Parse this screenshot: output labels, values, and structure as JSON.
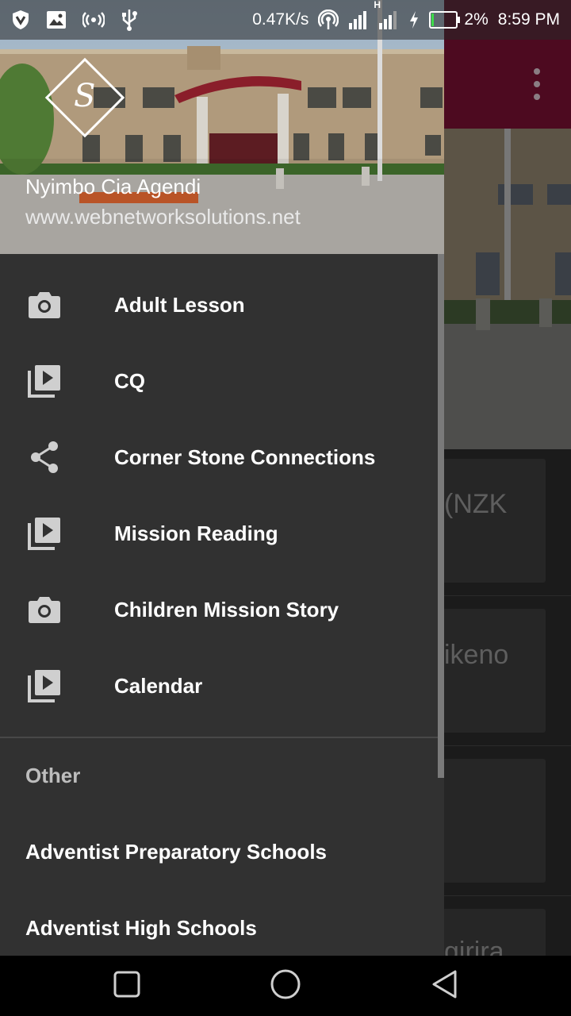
{
  "status_bar": {
    "speed": "0.47K/s",
    "network_type": "H",
    "battery": "2%",
    "time": "8:59 PM",
    "left_icons": [
      "shield-icon",
      "image-icon",
      "hotspot-icon",
      "usb-icon"
    ],
    "right_icons": [
      "antenna-icon",
      "signal-icon",
      "signal-h-icon",
      "charging-icon",
      "battery-icon"
    ]
  },
  "background_app": {
    "toolbar_color": "#4d0a20",
    "cards": [
      {
        "text": "(NZK"
      },
      {
        "text": "ikeno"
      },
      {
        "text": ""
      },
      {
        "text": "girira"
      }
    ]
  },
  "drawer": {
    "header": {
      "app_name": "Nyimbo Cia Agendi",
      "url": "www.webnetworksolutions.net",
      "logo_letter": "S"
    },
    "items": [
      {
        "label": "Adult Lesson",
        "icon": "camera-icon"
      },
      {
        "label": "CQ",
        "icon": "video-library-icon"
      },
      {
        "label": "Corner Stone Connections",
        "icon": "share-icon"
      },
      {
        "label": "Mission Reading",
        "icon": "video-library-icon"
      },
      {
        "label": "Children Mission Story",
        "icon": "camera-icon"
      },
      {
        "label": "Calendar",
        "icon": "video-library-icon"
      }
    ],
    "section_title": "Other",
    "other_items": [
      {
        "label": "Adventist Preparatory Schools"
      },
      {
        "label": "Adventist High Schools"
      }
    ]
  },
  "nav_bar": {
    "buttons": [
      "recents-icon",
      "home-icon",
      "back-icon"
    ]
  }
}
